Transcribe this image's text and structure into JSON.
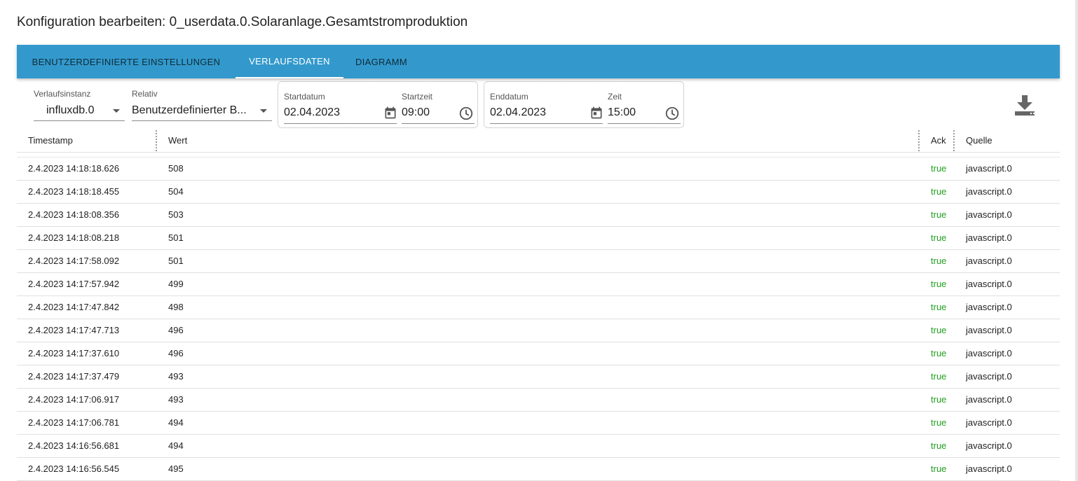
{
  "dialog": {
    "title": "Konfiguration bearbeiten: 0_userdata.0.Solaranlage.Gesamtstromproduktion"
  },
  "tabs": [
    {
      "label": "BENUTZERDEFINIERTE EINSTELLUNGEN",
      "active": false
    },
    {
      "label": "VERLAUFSDATEN",
      "active": true
    },
    {
      "label": "DIAGRAMM",
      "active": false
    }
  ],
  "filters": {
    "instance": {
      "label": "Verlaufsinstanz",
      "value": "influxdb.0"
    },
    "relative": {
      "label": "Relativ",
      "value": "Benutzerdefinierter B..."
    },
    "start_date": {
      "label": "Startdatum",
      "value": "02.04.2023"
    },
    "start_time": {
      "label": "Startzeit",
      "value": "09:00"
    },
    "end_date": {
      "label": "Enddatum",
      "value": "02.04.2023"
    },
    "end_time": {
      "label": "Zeit",
      "value": "15:00"
    }
  },
  "colors": {
    "accent": "#3399cc",
    "ack_true": "#22a022"
  },
  "table": {
    "columns": [
      "Timestamp",
      "Wert",
      "Ack",
      "Quelle"
    ],
    "rows": [
      {
        "timestamp": "2.4.2023 14:18:18.626",
        "value": "508",
        "ack": "true",
        "source": "javascript.0"
      },
      {
        "timestamp": "2.4.2023 14:18:18.455",
        "value": "504",
        "ack": "true",
        "source": "javascript.0"
      },
      {
        "timestamp": "2.4.2023 14:18:08.356",
        "value": "503",
        "ack": "true",
        "source": "javascript.0"
      },
      {
        "timestamp": "2.4.2023 14:18:08.218",
        "value": "501",
        "ack": "true",
        "source": "javascript.0"
      },
      {
        "timestamp": "2.4.2023 14:17:58.092",
        "value": "501",
        "ack": "true",
        "source": "javascript.0"
      },
      {
        "timestamp": "2.4.2023 14:17:57.942",
        "value": "499",
        "ack": "true",
        "source": "javascript.0"
      },
      {
        "timestamp": "2.4.2023 14:17:47.842",
        "value": "498",
        "ack": "true",
        "source": "javascript.0"
      },
      {
        "timestamp": "2.4.2023 14:17:47.713",
        "value": "496",
        "ack": "true",
        "source": "javascript.0"
      },
      {
        "timestamp": "2.4.2023 14:17:37.610",
        "value": "496",
        "ack": "true",
        "source": "javascript.0"
      },
      {
        "timestamp": "2.4.2023 14:17:37.479",
        "value": "493",
        "ack": "true",
        "source": "javascript.0"
      },
      {
        "timestamp": "2.4.2023 14:17:06.917",
        "value": "493",
        "ack": "true",
        "source": "javascript.0"
      },
      {
        "timestamp": "2.4.2023 14:17:06.781",
        "value": "494",
        "ack": "true",
        "source": "javascript.0"
      },
      {
        "timestamp": "2.4.2023 14:16:56.681",
        "value": "494",
        "ack": "true",
        "source": "javascript.0"
      },
      {
        "timestamp": "2.4.2023 14:16:56.545",
        "value": "495",
        "ack": "true",
        "source": "javascript.0"
      }
    ]
  }
}
